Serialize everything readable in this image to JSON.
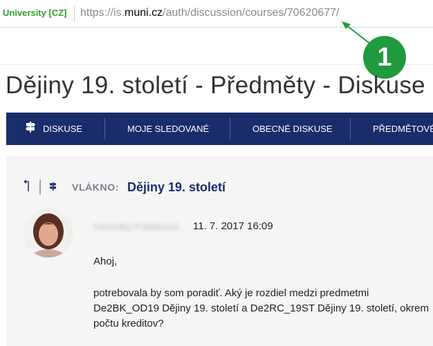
{
  "browser": {
    "cert_label": "University [CZ]",
    "url_prefix": "https://is.",
    "url_domain": "muni.cz",
    "url_path": "/auth/discussion/courses/70620677/"
  },
  "annotation": {
    "badge": "1"
  },
  "page": {
    "title": "Dějiny 19. století - Předměty - Diskuse"
  },
  "nav": {
    "items": [
      {
        "label": "DISKUSE",
        "icon": "signpost-icon"
      },
      {
        "label": "MOJE SLEDOVANÉ"
      },
      {
        "label": "OBECNÉ DISKUSE"
      },
      {
        "label": "PŘEDMĚTOVÉ"
      }
    ]
  },
  "thread": {
    "label": "VLÁKNO:",
    "title": "Dějiny 19. století"
  },
  "post": {
    "author": "Veronika Poláčková",
    "date": "11. 7. 2017 16:09",
    "greeting": "Ahoj,",
    "lines": [
      "potrebovala by som poradiť. Aký je rozdiel medzi predmetmi",
      "De2BK_OD19 Dějiny 19. století a De2RC_19ST Dějiny 19. století, okrem",
      "počtu kreditov?"
    ]
  },
  "colors": {
    "nav_bg": "#1a2d6b",
    "cert_green": "#2e9e2e",
    "badge_green": "#1f9a3d"
  }
}
